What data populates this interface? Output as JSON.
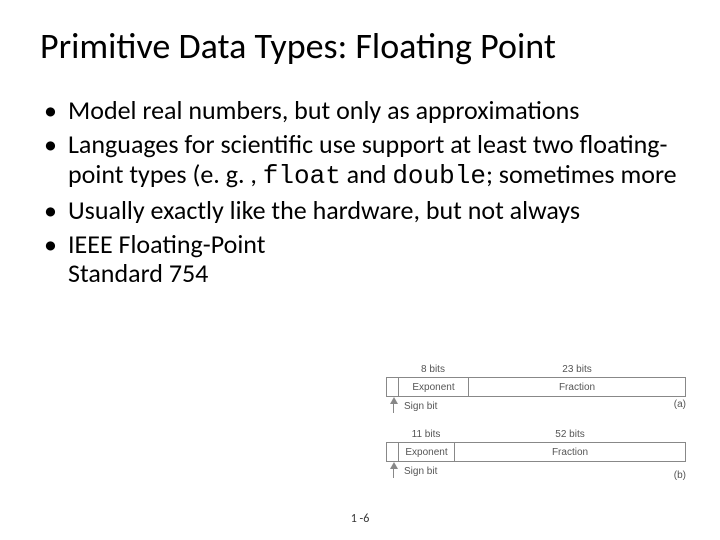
{
  "title": "Primitive Data Types: Floating Point",
  "bullets": {
    "b1": "Model real numbers, but only as approximations",
    "b2_pre": "Languages for scientific use support at least two floating-point types (e. g. , ",
    "b2_float": "float",
    "b2_mid": " and ",
    "b2_double": "double",
    "b2_post": "; sometimes more",
    "b3": "Usually exactly like the hardware, but not always",
    "b4": "IEEE Floating-Point Standard 754"
  },
  "figure": {
    "a": {
      "exp_bits": "8 bits",
      "frac_bits": "23 bits",
      "exp_label": "Exponent",
      "frac_label": "Fraction",
      "sign": "Sign bit",
      "tag": "(a)"
    },
    "b": {
      "exp_bits": "11 bits",
      "frac_bits": "52 bits",
      "exp_label": "Exponent",
      "frac_label": "Fraction",
      "sign": "Sign bit",
      "tag": "(b)"
    }
  },
  "footer": "1 -6"
}
